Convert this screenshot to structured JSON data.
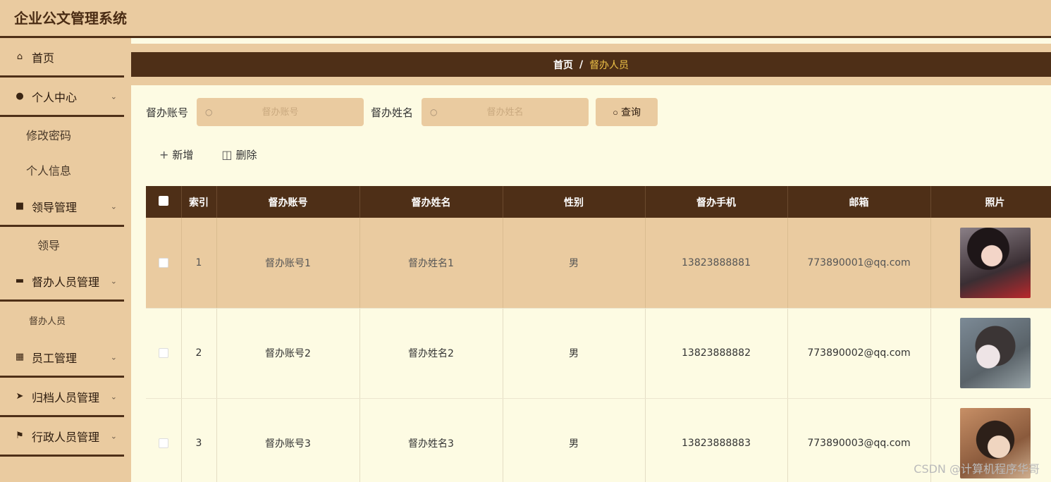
{
  "app": {
    "title": "企业公文管理系统"
  },
  "sidebar": {
    "home": "首页",
    "personal_center": "个人中心",
    "change_password": "修改密码",
    "personal_info": "个人信息",
    "leader_mgmt": "领导管理",
    "leader": "领导",
    "supervisor_mgmt": "督办人员管理",
    "supervisor": "督办人员",
    "staff_mgmt": "员工管理",
    "archive_mgmt": "归档人员管理",
    "admin_mgmt": "行政人员管理"
  },
  "breadcrumb": {
    "home": "首页",
    "separator": "/",
    "current": "督办人员"
  },
  "search": {
    "account_label": "督办账号",
    "account_placeholder": "督办账号",
    "name_label": "督办姓名",
    "name_placeholder": "督办姓名",
    "query_button": "查询"
  },
  "actions": {
    "add": "新增",
    "delete": "删除"
  },
  "table": {
    "headers": [
      "索引",
      "督办账号",
      "督办姓名",
      "性别",
      "督办手机",
      "邮箱",
      "照片"
    ],
    "rows": [
      {
        "index": "1",
        "account": "督办账号1",
        "name": "督办姓名1",
        "gender": "男",
        "phone": "13823888881",
        "email": "773890001@qq.com"
      },
      {
        "index": "2",
        "account": "督办账号2",
        "name": "督办姓名2",
        "gender": "男",
        "phone": "13823888882",
        "email": "773890002@qq.com"
      },
      {
        "index": "3",
        "account": "督办账号3",
        "name": "督办姓名3",
        "gender": "男",
        "phone": "13823888883",
        "email": "773890003@qq.com"
      }
    ]
  },
  "watermark": "CSDN @计算机程序华哥"
}
